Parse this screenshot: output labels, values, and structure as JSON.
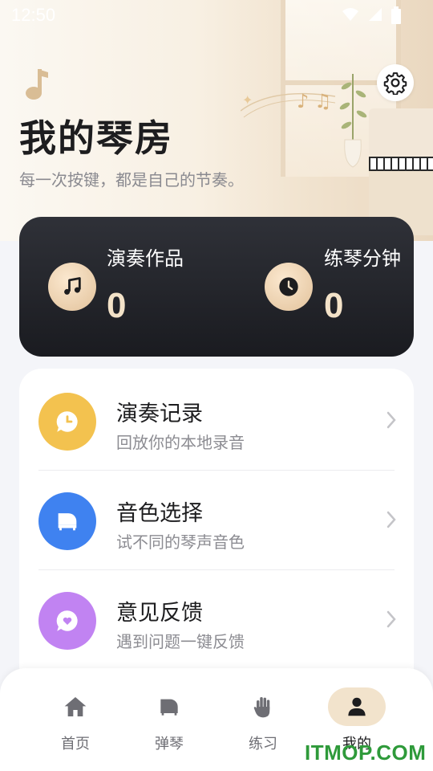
{
  "status_bar": {
    "time": "12:50"
  },
  "header": {
    "title": "我的琴房",
    "subtitle": "每一次按键，都是自己的节奏。"
  },
  "stats": {
    "works": {
      "label": "演奏作品",
      "value": "0",
      "icon": "music-note-icon"
    },
    "minutes": {
      "label": "练琴分钟",
      "value": "0",
      "icon": "clock-icon"
    }
  },
  "menu": [
    {
      "title": "演奏记录",
      "desc": "回放你的本地录音",
      "icon": "recording-clock-icon",
      "color": "#f3c24f"
    },
    {
      "title": "音色选择",
      "desc": "试不同的琴声音色",
      "icon": "piano-icon",
      "color": "#3f82f0"
    },
    {
      "title": "意见反馈",
      "desc": "遇到问题一键反馈",
      "icon": "feedback-heart-icon",
      "color": "#c183f2"
    }
  ],
  "bottom_nav": [
    {
      "label": "首页",
      "icon": "home-icon"
    },
    {
      "label": "弹琴",
      "icon": "piano-icon"
    },
    {
      "label": "练习",
      "icon": "hand-icon"
    },
    {
      "label": "我的",
      "icon": "person-icon",
      "active": true
    }
  ],
  "watermark": "ITMOP.COM",
  "colors": {
    "accent_gold": "#e2c29b",
    "dark_card": "#1a1b20",
    "nav_active_bg": "#f2e3cc"
  }
}
